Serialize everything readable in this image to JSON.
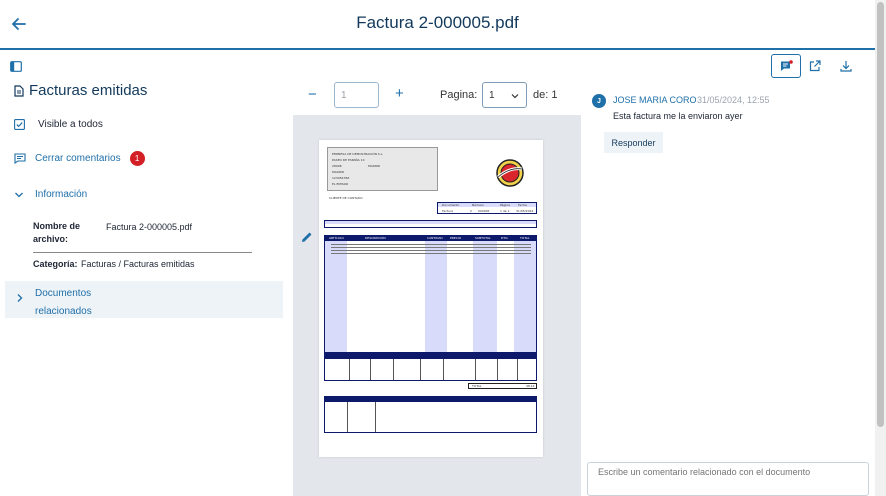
{
  "header": {
    "title": "Factura 2-000005.pdf"
  },
  "left_panel": {
    "section_title": "Facturas emitidas",
    "visible_label": "Visible a todos",
    "comments_toggle_label": "Cerrar comentarios",
    "comments_count": "1",
    "info_label": "Información",
    "name_label_line1": "Nombre de",
    "name_label_line2": "archivo:",
    "name_value": "Factura 2-000005.pdf",
    "category_label": "Categoría:",
    "category_value": "Facturas / Facturas emitidas",
    "related_docs_line1": "Documentos",
    "related_docs_line2": "relacionados"
  },
  "viewer": {
    "zoom_out": "−",
    "zoom_in": "+",
    "zoom_placeholder": "1",
    "page_label": "Pagina:",
    "page_selected": "1",
    "page_total_label": "de: 1"
  },
  "pdf_page": {
    "company_lines": [
      "EMPRESA DE DEMOSTRACIÓN S.L.",
      "PASEO DE ESPAÑA 10",
      "28008",
      "MADRID",
      "MADRID",
      "12345678Z",
      "EL EMISOR"
    ],
    "client": "CLIENTE DE CONTADO",
    "doc_headers": [
      "Documento",
      "Número",
      "Página",
      "Fecha"
    ],
    "doc_values": [
      "Factura",
      "2",
      "000005",
      "1 de 1",
      "31/05/2024"
    ],
    "table_headers": [
      "ARTÍCULO",
      "DESCRIPCIÓN",
      "CANTIDAD",
      "PRECIO",
      "SUBTOTAL",
      "DTO.",
      "TOTAL"
    ],
    "total_label": "TOTAL",
    "total_value": "48,14"
  },
  "comments": {
    "avatar_initial": "J",
    "author": "JOSE MARIA CORO",
    "date": "31/05/2024, 12:55",
    "text": "Esta factura me la enviaron ayer",
    "reply_label": "Responder",
    "input_placeholder": "Escribe un comentario relacionado con el documento"
  },
  "colors": {
    "primary": "#1f6fa8",
    "title": "#12395c",
    "badge": "#d32027",
    "navy_table": "#0d1a6b"
  }
}
